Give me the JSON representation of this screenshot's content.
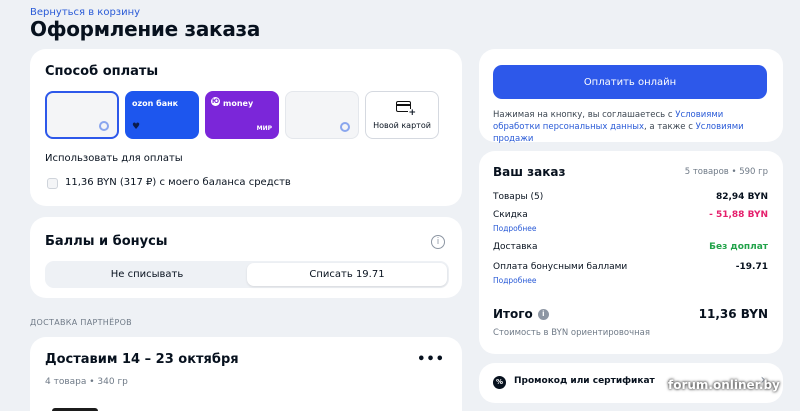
{
  "header": {
    "back_link": "Вернуться в корзину",
    "title": "Оформление заказа"
  },
  "payment": {
    "title": "Способ оплаты",
    "methods": [
      {
        "type": "card-selected"
      },
      {
        "type": "ozon-bank",
        "label": "ozon банк"
      },
      {
        "type": "yoomoney",
        "label": "money",
        "badge": "МИР"
      },
      {
        "type": "card"
      },
      {
        "type": "new-card",
        "label": "Новой картой"
      }
    ],
    "use_for_payment": "Использовать для оплаты",
    "balance_option": "11,36 BYN (317 ₽) с моего баланса средств"
  },
  "bonuses": {
    "title": "Баллы и бонусы",
    "options": [
      "Не списывать",
      "Списать 19.71"
    ],
    "selected_index": 1
  },
  "partner_delivery": {
    "section_label": "ДОСТАВКА ПАРТНЁРОВ",
    "title": "Доставим 14 – 23 октября",
    "subtitle": "4 товара • 340 гр"
  },
  "checkout": {
    "pay_button": "Оплатить онлайн",
    "agree_prefix": "Нажимая на кнопку, вы соглашаетесь с ",
    "agree_link1": "Условиями обработки персональных данных",
    "agree_middle": ", а также с ",
    "agree_link2": "Условиями продажи"
  },
  "order": {
    "title": "Ваш заказ",
    "meta": "5 товаров • 590 гр",
    "rows": [
      {
        "label": "Товары (5)",
        "value": "82,94 BYN"
      },
      {
        "label": "Скидка",
        "value": "- 51,88 BYN"
      },
      {
        "label": "Доставка",
        "value": "Без доплат"
      },
      {
        "label": "Оплата бонусными баллами",
        "value": "-19.71"
      }
    ],
    "more_link": "Подробнее",
    "total_label": "Итого",
    "total_value": "11,36 BYN",
    "total_note": "Стоимость в BYN ориентировочная"
  },
  "promo": {
    "label": "Промокод или сертификат"
  },
  "watermark": "forum.onliner.by",
  "colors": {
    "accent": "#2d58ea",
    "discount": "#e51f6c",
    "free": "#22a34a",
    "ozon": "#1d56ee",
    "yoomoney": "#7b26d9"
  }
}
